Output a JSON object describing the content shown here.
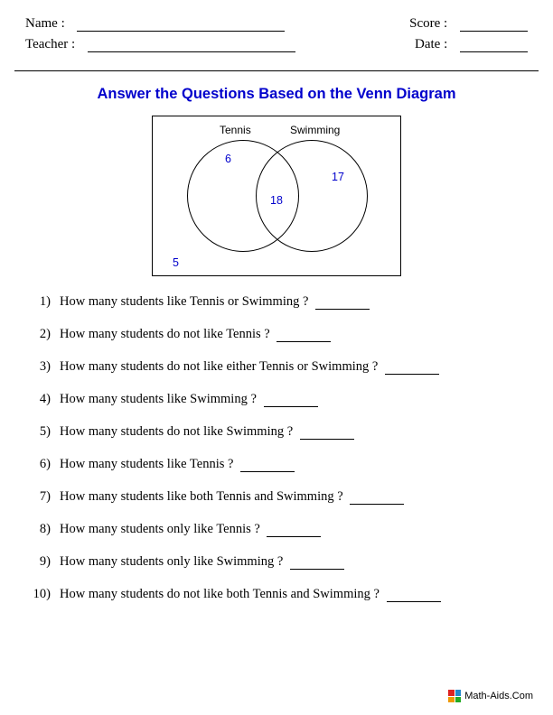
{
  "header": {
    "name_label": "Name : ",
    "teacher_label": "Teacher : ",
    "score_label": "Score : ",
    "date_label": "Date : "
  },
  "title": "Answer the Questions Based on the Venn Diagram",
  "venn": {
    "left_label": "Tennis",
    "right_label": "Swimming",
    "left_only": "6",
    "right_only": "17",
    "intersection": "18",
    "outside": "5"
  },
  "questions": [
    {
      "n": "1)",
      "text": "How many students like Tennis or Swimming ? "
    },
    {
      "n": "2)",
      "text": "How many students do not like Tennis ? "
    },
    {
      "n": "3)",
      "text": "How many students do not like either Tennis or Swimming ? "
    },
    {
      "n": "4)",
      "text": "How many students like Swimming ? "
    },
    {
      "n": "5)",
      "text": "How many students do not like Swimming ? "
    },
    {
      "n": "6)",
      "text": "How many students like Tennis ? "
    },
    {
      "n": "7)",
      "text": "How many students like both Tennis and Swimming ? "
    },
    {
      "n": "8)",
      "text": "How many students only like Tennis ? "
    },
    {
      "n": "9)",
      "text": "How many students only like Swimming ? "
    },
    {
      "n": "10)",
      "text": "How many students do not like both Tennis and Swimming ? "
    }
  ],
  "footer": "Math-Aids.Com",
  "chart_data": {
    "type": "venn",
    "sets": [
      "Tennis",
      "Swimming"
    ],
    "regions": {
      "tennis_only": 6,
      "swimming_only": 17,
      "both": 18,
      "neither": 5
    }
  }
}
